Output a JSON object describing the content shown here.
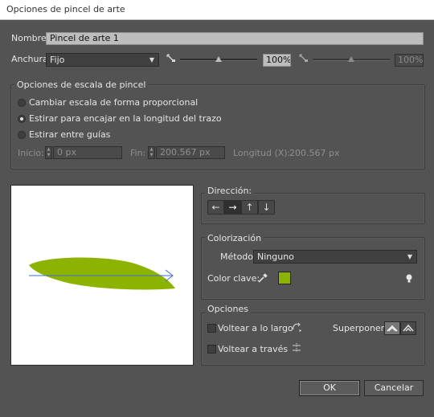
{
  "window": {
    "title": "Opciones de pincel de arte"
  },
  "name_row": {
    "label": "Nombre:",
    "value": "Pincel de arte 1"
  },
  "width_row": {
    "label": "Anchura:",
    "select_value": "Fijo",
    "slider1_value": "100%",
    "slider2_value": "100%"
  },
  "scale_group": {
    "legend": "Opciones de escala de pincel",
    "options": [
      {
        "label": "Cambiar escala de forma proporcional",
        "selected": false
      },
      {
        "label": "Estirar para encajar en la longitud del trazo",
        "selected": true
      },
      {
        "label": "Estirar entre guías",
        "selected": false
      }
    ],
    "start_label": "Inicio:",
    "start_value": "0 px",
    "end_label": "Fin:",
    "end_value": "200.567 px",
    "length_label": "Longitud (X):",
    "length_value": "200.567 px"
  },
  "direction": {
    "legend": "Dirección:",
    "buttons": [
      "←",
      "→",
      "↑",
      "↓"
    ],
    "selected_index": 1
  },
  "colorization": {
    "legend": "Colorización",
    "method_label": "Método:",
    "method_value": "Ninguno",
    "key_color_label": "Color clave:",
    "key_color": "#8cb300"
  },
  "options": {
    "legend": "Opciones",
    "flip_along": "Voltear a lo largo",
    "flip_across": "Voltear a través",
    "overlap_label": "Superponer:"
  },
  "buttons": {
    "ok": "OK",
    "cancel": "Cancelar"
  },
  "colors": {
    "leaf": "#8cb300",
    "arrow": "#3b6fd6"
  }
}
